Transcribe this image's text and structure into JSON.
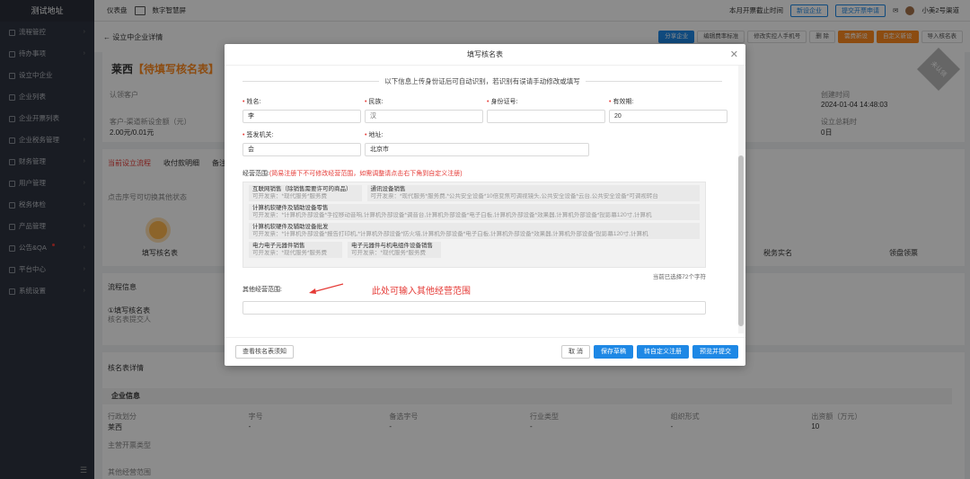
{
  "sidebar": {
    "title": "测试地址",
    "items": [
      {
        "label": "流程管控"
      },
      {
        "label": "待办事项"
      },
      {
        "label": "设立中企业"
      },
      {
        "label": "企业列表"
      },
      {
        "label": "企业开票列表"
      },
      {
        "label": "企业税务管理"
      },
      {
        "label": "财务管理"
      },
      {
        "label": "用户管理"
      },
      {
        "label": "税务体检"
      },
      {
        "label": "产品管理"
      },
      {
        "label": "公告&QA"
      },
      {
        "label": "平台中心"
      },
      {
        "label": "系统设置"
      }
    ]
  },
  "topbar": {
    "dashboard": "仪表盘",
    "screen": "数字智慧屏",
    "notice": "本月开票截止时间",
    "new_company": "新设企业",
    "apply_invoice": "提交开票申请",
    "user": "小美2号渠道"
  },
  "subheader": {
    "back": "← 设立中企业详情",
    "actions": [
      "分享企业",
      "编辑费率标准",
      "修改实控人手机号",
      "删 除",
      "需费新设",
      "自定义新设",
      "导入核名表"
    ]
  },
  "page": {
    "company": "莱西",
    "status": "【待填写核名表】",
    "stamp": "未认领",
    "label_customer": "认领客户",
    "label_fee": "客户-渠道新设金额（元）",
    "fee": "2.00元/0.01元",
    "label_created": "创建时间",
    "created": "2024-01-04 14:48:03",
    "label_days": "设立总耗时",
    "days": "0日",
    "tabs": [
      "当前设立流程",
      "收付款明细",
      "备注"
    ],
    "step_hint": "点击序号可切换其他状态",
    "steps": [
      "填写核名表",
      "税务实名",
      "领盘领票"
    ],
    "flow_title": "流程信息",
    "flow_item": "①填写核名表",
    "flow_sub": "核名表提交人",
    "form_title": "核名表详情",
    "info_title": "企业信息",
    "info_cols": [
      "行政划分",
      "字号",
      "备选字号",
      "行业类型",
      "组织形式",
      "出资额（万元）"
    ],
    "info_vals": [
      "莱西",
      "-",
      "-",
      "-",
      "-",
      "10"
    ],
    "main_type": "主营开票类型",
    "other_scope": "其他经营范围"
  },
  "modal": {
    "title": "填写核名表",
    "notice": "以下信息上传身份证后可自动识别，若识别有误请手动修改或填写",
    "fields": [
      {
        "label": "姓名:",
        "value": "李"
      },
      {
        "label": "民族:",
        "value": "汉"
      },
      {
        "label": "身份证号:",
        "value": ""
      },
      {
        "label": "有效期:",
        "value": "20"
      },
      {
        "label": "签发机关:",
        "value": "会"
      },
      {
        "label": "地址:",
        "value": "北京市"
      }
    ],
    "scope_label": "经营范围:",
    "scope_hint": "(简易注册下不可修改经营范围，如需调整请点击右下角到自定义注册)",
    "scope_items": [
      {
        "name": "互联网销售（除销售需要许可的商品）",
        "sub": "可开发票：*现代服务*服务费"
      },
      {
        "name": "通讯设备销售",
        "sub": "可开发票：*现代服务*服务费,*公共安全设备*10倍变焦可调视镜头,公共安全设备*云台,公共安全设备*可调视转台"
      },
      {
        "name": "计算机软硬件及辅助设备零售",
        "sub": "可开发票：*计算机外部设备*手控移动音响,计算机外部设备*调音台,计算机外部设备*电子白板,计算机外部设备*效果器,计算机外部设备*投影幕120寸,计算机"
      },
      {
        "name": "计算机软硬件及辅助设备批发",
        "sub": "可开发票：*计算机外部设备*报告打印机,*计算机外部设备*防火墙,计算机外部设备*电子白板,计算机外部设备*效果器,计算机外部设备*投影幕120寸,计算机"
      },
      {
        "name": "电力电子元器件销售",
        "sub": "可开发票：*现代服务*服务费"
      },
      {
        "name": "电子元器件与机电组件设备销售",
        "sub": "可开发票：*现代服务*服务费"
      }
    ],
    "count": "当前已选择72个字符",
    "other_label": "其他经营范围:",
    "annotation": "此处可输入其他经营范围",
    "footer": {
      "help": "查看核名表须知",
      "cancel": "取 消",
      "save": "保存草稿",
      "custom": "转自定义注册",
      "submit": "预览并提交"
    }
  },
  "colors": {
    "primary": "#1e88e5",
    "accent": "#ff8a1f",
    "danger": "#e53935",
    "sidebar": "#2f3440"
  }
}
